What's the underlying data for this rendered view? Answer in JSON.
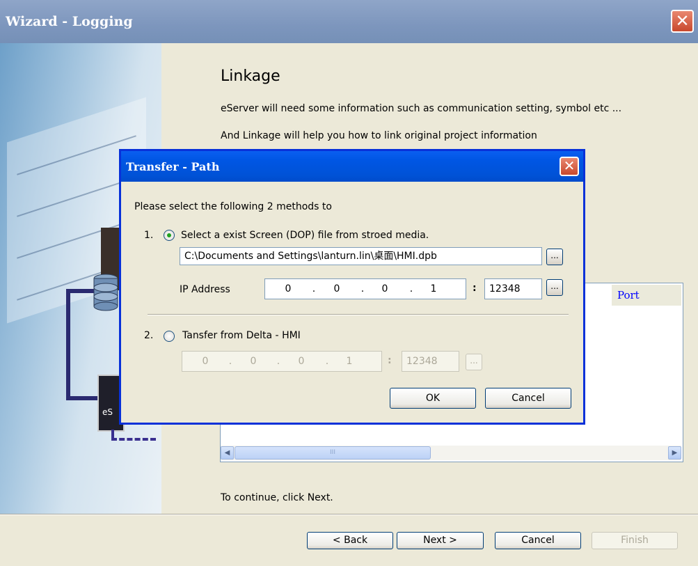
{
  "wizard": {
    "title": "Wizard - Logging",
    "heading": "Linkage",
    "desc1": "eServer will need some information such as communication setting, symbol etc ...",
    "desc2": "And Linkage will help you how to link original project information",
    "list_port_header": "Port",
    "continue_text": "To continue, click Next.",
    "art_label": "eS",
    "buttons": {
      "back": "< Back",
      "next": "Next >",
      "cancel": "Cancel",
      "finish": "Finish"
    }
  },
  "dialog": {
    "title": "Transfer - Path",
    "instruction": "Please select the following 2 methods to",
    "option1": {
      "number": "1.",
      "label": "Select a exist  Screen (DOP) file from stroed media.",
      "selected": true,
      "path": "C:\\Documents and Settings\\lanturn.lin\\桌面\\HMI.dpb",
      "ip_label": "IP Address",
      "ip": [
        "0",
        "0",
        "0",
        "1"
      ],
      "port": "12348"
    },
    "option2": {
      "number": "2.",
      "label": "Tansfer from Delta - HMI",
      "selected": false,
      "ip": [
        "0",
        "0",
        "0",
        "1"
      ],
      "port": "12348"
    },
    "browse_label": "...",
    "ok_label": "OK",
    "cancel_label": "Cancel"
  }
}
